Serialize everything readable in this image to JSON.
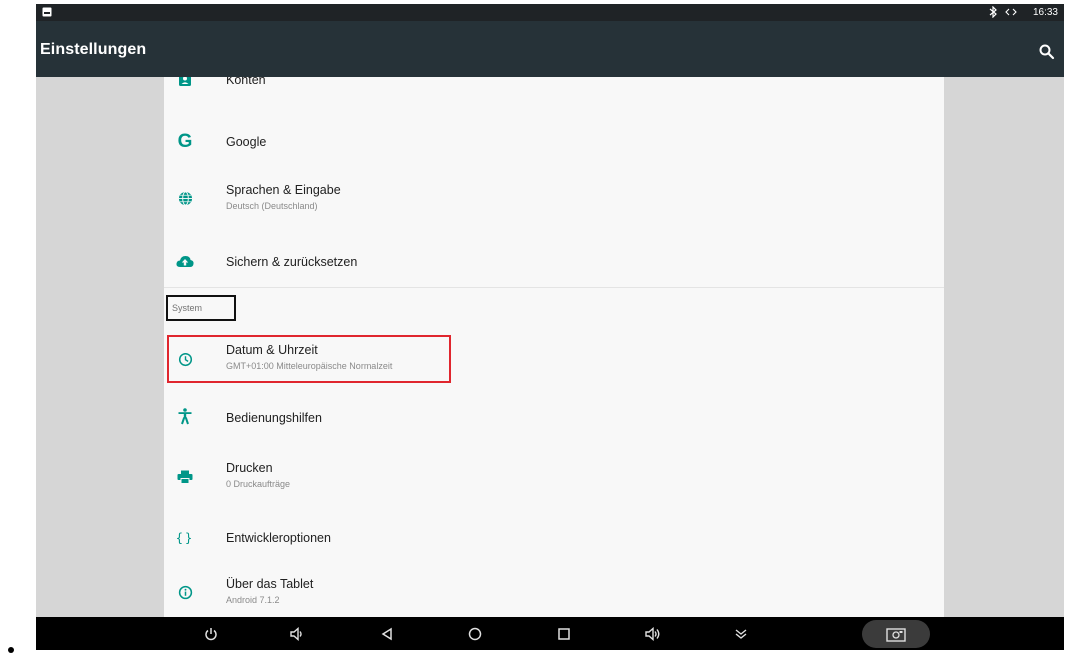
{
  "status_bar": {
    "time": "16:33",
    "icons": [
      "image-notification-icon",
      "bluetooth-icon",
      "data-transfer-icon"
    ]
  },
  "app_bar": {
    "title": "Einstellungen",
    "action_icon": "search-icon"
  },
  "settings": {
    "items_top": [
      {
        "icon": "account-icon",
        "title": "Konten",
        "subtitle": ""
      },
      {
        "icon": "google-icon",
        "title": "Google",
        "subtitle": ""
      },
      {
        "icon": "globe-icon",
        "title": "Sprachen & Eingabe",
        "subtitle": "Deutsch (Deutschland)"
      },
      {
        "icon": "cloud-upload-icon",
        "title": "Sichern & zurücksetzen",
        "subtitle": ""
      }
    ],
    "category": "System",
    "items_system": [
      {
        "icon": "clock-icon",
        "title": "Datum & Uhrzeit",
        "subtitle": "GMT+01:00 Mitteleuropäische Normalzeit"
      },
      {
        "icon": "accessibility-icon",
        "title": "Bedienungshilfen",
        "subtitle": ""
      },
      {
        "icon": "printer-icon",
        "title": "Drucken",
        "subtitle": "0 Druckaufträge"
      },
      {
        "icon": "developer-braces-icon",
        "title": "Entwickleroptionen",
        "subtitle": ""
      },
      {
        "icon": "info-icon",
        "title": "Über das Tablet",
        "subtitle": "Android 7.1.2"
      }
    ]
  },
  "nav_bar": {
    "buttons": [
      "power-icon",
      "volume-down-icon",
      "back-icon",
      "home-icon",
      "recents-icon",
      "volume-up-icon",
      "collapse-icon",
      "screenshot-icon"
    ]
  },
  "colors": {
    "status_bar": "#1f2326",
    "app_bar": "#263238",
    "accent": "#009688",
    "highlight_red": "#e0262e",
    "category_box": "#111111"
  }
}
